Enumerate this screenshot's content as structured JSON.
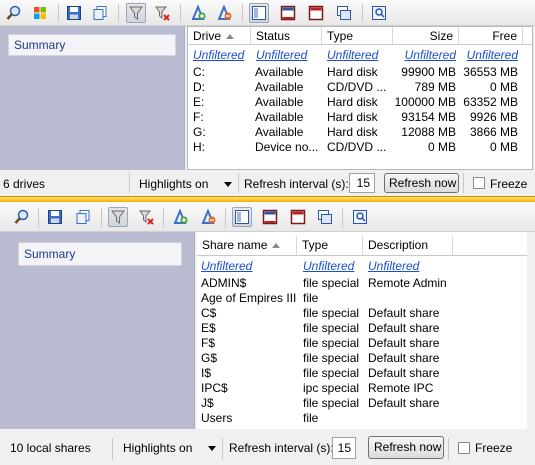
{
  "top": {
    "summary_label": "Summary",
    "columns": [
      "Drive",
      "Status",
      "Type",
      "Size",
      "Free"
    ],
    "filter_text": "Unfiltered",
    "rows": [
      {
        "drive": "C:",
        "status": "Available",
        "type": "Hard disk",
        "size": "99900 MB",
        "free": "36553 MB"
      },
      {
        "drive": "D:",
        "status": "Available",
        "type": "CD/DVD ...",
        "size": "789 MB",
        "free": "0 MB"
      },
      {
        "drive": "E:",
        "status": "Available",
        "type": "Hard disk",
        "size": "100000 MB",
        "free": "63352 MB"
      },
      {
        "drive": "F:",
        "status": "Available",
        "type": "Hard disk",
        "size": "93154 MB",
        "free": "9926 MB"
      },
      {
        "drive": "G:",
        "status": "Available",
        "type": "Hard disk",
        "size": "12088 MB",
        "free": "3866 MB"
      },
      {
        "drive": "H:",
        "status": "Device no...",
        "type": "CD/DVD ...",
        "size": "0 MB",
        "free": "0 MB"
      }
    ],
    "status": {
      "count": "6 drives",
      "highlights": "Highlights on",
      "refresh_label": "Refresh interval (s):",
      "refresh_value": "15",
      "refresh_button": "Refresh now",
      "freeze": "Freeze"
    }
  },
  "bottom": {
    "summary_label": "Summary",
    "columns": [
      "Share name",
      "Type",
      "Description"
    ],
    "filter_text": "Unfiltered",
    "rows": [
      {
        "name": "ADMIN$",
        "type": "file special",
        "desc": "Remote Admin"
      },
      {
        "name": "Age of Empires III",
        "type": "file",
        "desc": ""
      },
      {
        "name": "C$",
        "type": "file special",
        "desc": "Default share"
      },
      {
        "name": "E$",
        "type": "file special",
        "desc": "Default share"
      },
      {
        "name": "F$",
        "type": "file special",
        "desc": "Default share"
      },
      {
        "name": "G$",
        "type": "file special",
        "desc": "Default share"
      },
      {
        "name": "I$",
        "type": "file special",
        "desc": "Default share"
      },
      {
        "name": "IPC$",
        "type": "ipc special",
        "desc": "Remote IPC"
      },
      {
        "name": "J$",
        "type": "file special",
        "desc": "Default share"
      },
      {
        "name": "Users",
        "type": "file",
        "desc": ""
      }
    ],
    "status": {
      "count": "10 local shares",
      "highlights": "Highlights on",
      "refresh_label": "Refresh interval (s):",
      "refresh_value": "15",
      "refresh_button": "Refresh now",
      "freeze": "Freeze"
    }
  },
  "icons": {
    "toolbar": [
      "search-icon",
      "windows-logo-icon",
      "save-icon",
      "copy-icon",
      "filter-icon",
      "clear-filter-icon",
      "add-column-icon",
      "remove-column-icon",
      "layout-single-icon",
      "layout-horizontal-icon",
      "layout-vertical-icon",
      "new-window-icon",
      "properties-icon"
    ]
  },
  "colors": {
    "sidebar": "#b9bcd0",
    "filter_link": "#1a4fd0",
    "divider": "#f2b200"
  }
}
